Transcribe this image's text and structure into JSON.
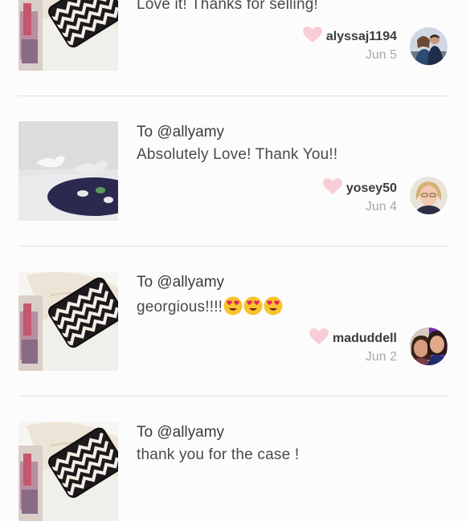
{
  "comments": [
    {
      "to": "",
      "message": "Love it! Thanks for selling!",
      "username": "alyssaj1194",
      "date": "Jun 5",
      "thumbnail": "chevron-case-photo",
      "avatar": "couple-photo"
    },
    {
      "to": "To @allyamy",
      "message": "Absolutely Love! Thank You!!",
      "username": "yosey50",
      "date": "Jun 4",
      "thumbnail": "bird-figurines-photo",
      "avatar": "blonde-woman-photo"
    },
    {
      "to": "To @allyamy",
      "message": "georgious!!!!",
      "emoji_count": 3,
      "emoji": "heart-eyes-emoji",
      "username": "maduddell",
      "date": "Jun 2",
      "thumbnail": "chevron-case-photo",
      "avatar": "two-women-photo"
    },
    {
      "to": "To @allyamy",
      "message": "thank you for the case !",
      "username": "",
      "date": "",
      "thumbnail": "chevron-case-photo",
      "avatar": ""
    }
  ],
  "colors": {
    "heart": "#f9cdd6",
    "divider": "#e1dfe1",
    "date": "#a9a9a9"
  }
}
